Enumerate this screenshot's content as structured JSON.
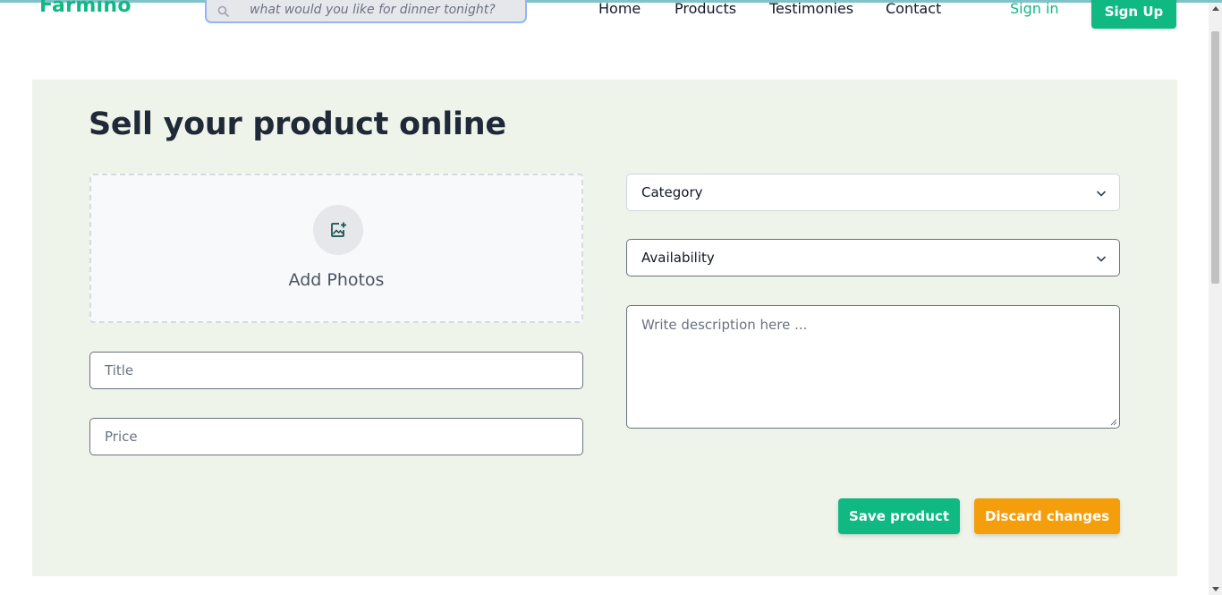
{
  "brand": {
    "name": "Farmino",
    "color": "#10b981"
  },
  "search": {
    "placeholder": "what would you like for dinner tonight?",
    "value": ""
  },
  "nav": {
    "home": "Home",
    "products": "Products",
    "testimonies": "Testimonies",
    "contact": "Contact"
  },
  "auth": {
    "sign_in": "Sign in",
    "sign_up": "Sign Up"
  },
  "form": {
    "heading": "Sell your product online",
    "add_photos": "Add Photos",
    "title_placeholder": "Title",
    "price_placeholder": "Price",
    "category_selected": "Category",
    "availability_selected": "Availability",
    "description_placeholder": "Write description here ..."
  },
  "actions": {
    "save": "Save product",
    "discard": "Discard changes"
  },
  "colors": {
    "accent": "#10b981",
    "warning": "#f59e0b",
    "panel": "#eff4eb"
  }
}
